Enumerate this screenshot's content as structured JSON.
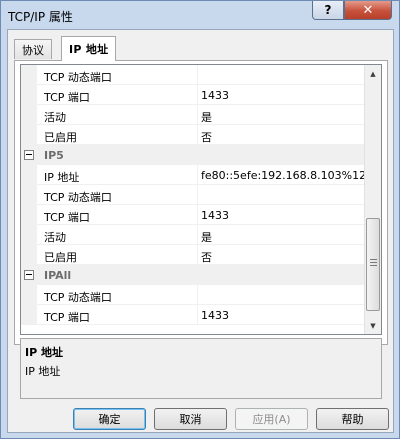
{
  "window": {
    "title": "TCP/IP 属性"
  },
  "titlebar_buttons": {
    "help_glyph": "?",
    "close_glyph": "✕"
  },
  "tabs": [
    {
      "label": "协议",
      "active": false
    },
    {
      "label": "IP 地址",
      "active": true
    }
  ],
  "grid": {
    "rows": [
      {
        "kind": "prop",
        "name": "TCP 动态端口",
        "value": ""
      },
      {
        "kind": "prop",
        "name": "TCP 端口",
        "value": "1433"
      },
      {
        "kind": "prop",
        "name": "活动",
        "value": "是"
      },
      {
        "kind": "prop",
        "name": "已启用",
        "value": "否"
      },
      {
        "kind": "cat",
        "name": "IP5"
      },
      {
        "kind": "prop",
        "name": "IP 地址",
        "value": "fe80::5efe:192.168.8.103%12"
      },
      {
        "kind": "prop",
        "name": "TCP 动态端口",
        "value": ""
      },
      {
        "kind": "prop",
        "name": "TCP 端口",
        "value": "1433"
      },
      {
        "kind": "prop",
        "name": "活动",
        "value": "是"
      },
      {
        "kind": "prop",
        "name": "已启用",
        "value": "否"
      },
      {
        "kind": "cat",
        "name": "IPAll"
      },
      {
        "kind": "prop",
        "name": "TCP 动态端口",
        "value": ""
      },
      {
        "kind": "prop",
        "name": "TCP 端口",
        "value": "1433"
      }
    ]
  },
  "description": {
    "title": "IP 地址",
    "text": "IP 地址"
  },
  "buttons": {
    "ok": "确定",
    "cancel": "取消",
    "apply": "应用(A)",
    "help": "帮助"
  },
  "icons": {
    "scroll_up": "▲",
    "scroll_down": "▼"
  }
}
